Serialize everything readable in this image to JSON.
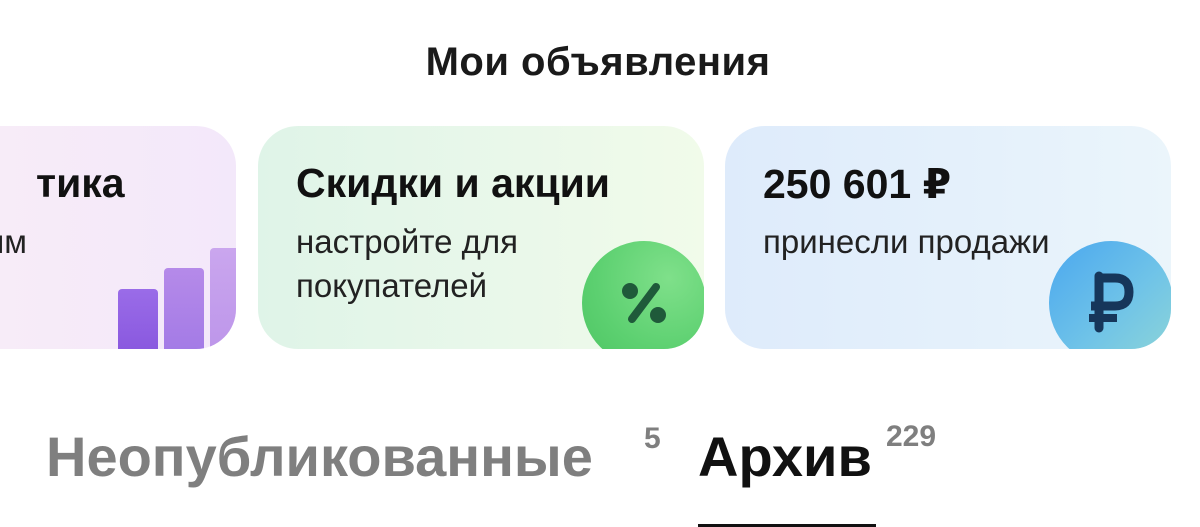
{
  "page": {
    "title": "Мои объявления"
  },
  "cards": [
    {
      "id": "analytics",
      "title": "тика",
      "subtitle": "иям",
      "icon": "bar-chart-icon",
      "colors": [
        "#8a59df",
        "#a47be6",
        "#bd96ea"
      ]
    },
    {
      "id": "discounts",
      "title": "Скидки и акции",
      "subtitle": "настройте для покупателей",
      "icon": "percent-icon",
      "accent": "#5cd070"
    },
    {
      "id": "sales",
      "title": "250 601 ₽",
      "subtitle": "принесли продажи",
      "icon": "ruble-icon",
      "accent": "#4aa7ef"
    }
  ],
  "tabs": [
    {
      "label": "Неопубликованные",
      "count": "5",
      "active": false
    },
    {
      "label": "Архив",
      "count": "229",
      "active": true
    }
  ]
}
